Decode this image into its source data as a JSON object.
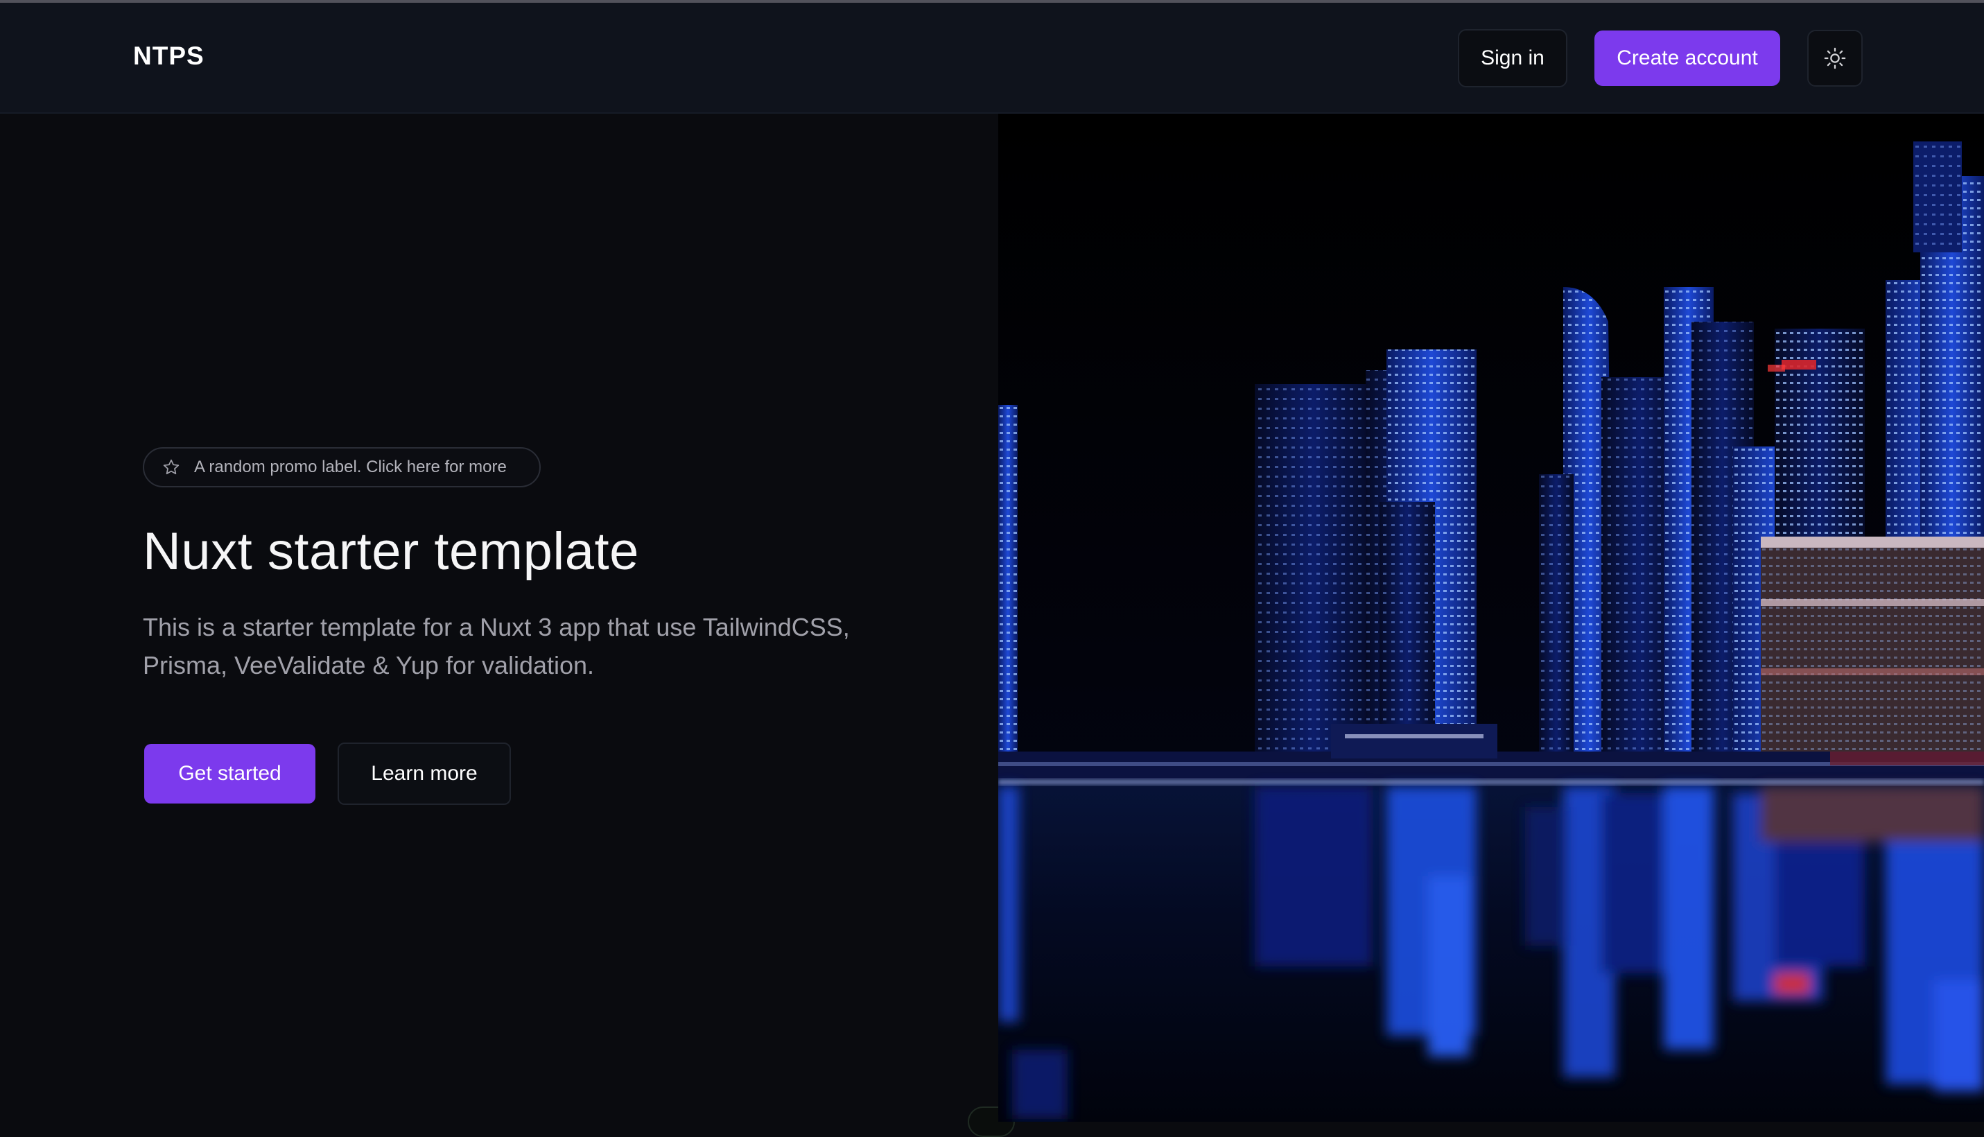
{
  "brand": "NTPS",
  "nav": {
    "sign_in": "Sign in",
    "create_account": "Create account",
    "theme_icon": "sun-icon"
  },
  "hero": {
    "promo_icon": "star-icon",
    "promo_label": "A random promo label. Click here for more",
    "title": "Nuxt starter template",
    "description": "This is a starter template for a Nuxt 3 app that use TailwindCSS, Prisma, VeeValidate & Yup for validation.",
    "primary_button": "Get started",
    "secondary_button": "Learn more"
  },
  "image": {
    "subject": "night city skyline reflected on water"
  },
  "colors": {
    "accent": "#7c3aed",
    "background": "#0a0b0f",
    "header_bg": "#0f131c"
  }
}
